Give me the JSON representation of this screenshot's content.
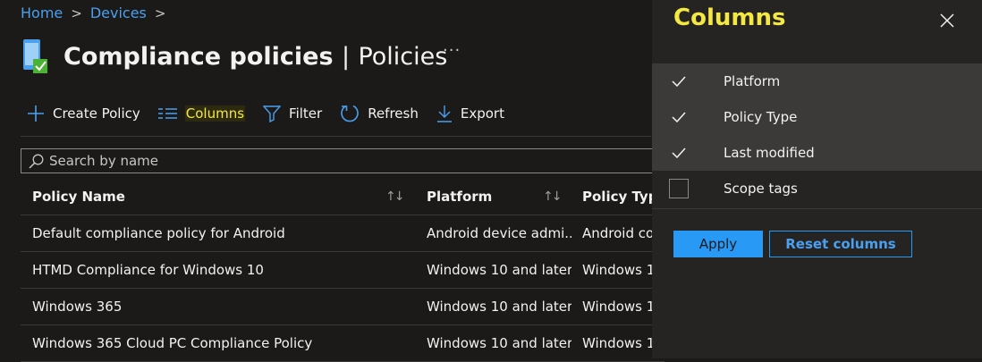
{
  "breadcrumb": {
    "items": [
      "Home",
      "Devices"
    ]
  },
  "page": {
    "title": "Compliance policies",
    "subtitle": "Policies",
    "separator": "|",
    "more": "···"
  },
  "toolbar": {
    "create": "Create Policy",
    "columns": "Columns",
    "filter": "Filter",
    "refresh": "Refresh",
    "export": "Export"
  },
  "search": {
    "placeholder": "Search by name",
    "value": ""
  },
  "table": {
    "headers": [
      "Policy Name",
      "Platform",
      "Policy Type"
    ],
    "rows": [
      [
        "Default compliance policy for Android",
        "Android device admi...",
        "Android co"
      ],
      [
        "HTMD Compliance for Windows 10",
        "Windows 10 and later",
        "Windows 1"
      ],
      [
        "Windows 365",
        "Windows 10 and later",
        "Windows 1"
      ],
      [
        "Windows 365 Cloud PC Compliance Policy",
        "Windows 10 and later",
        "Windows 1"
      ]
    ]
  },
  "panel": {
    "title": "Columns",
    "options": [
      {
        "label": "Platform",
        "checked": true
      },
      {
        "label": "Policy Type",
        "checked": true
      },
      {
        "label": "Last modified",
        "checked": true
      },
      {
        "label": "Scope tags",
        "checked": false
      }
    ],
    "apply": "Apply",
    "reset": "Reset columns"
  },
  "colors": {
    "background": "#1b1a19",
    "panel": "#252423",
    "accent": "#2899f5",
    "link": "#4aa0ef",
    "highlight_text": "#f4e842"
  },
  "icons": {
    "title": "device-compliance-icon",
    "create": "plus-icon",
    "columns": "columns-icon",
    "filter": "filter-icon",
    "refresh": "refresh-icon",
    "export": "download-icon",
    "search": "search-icon",
    "close": "close-icon",
    "sort": "sort-arrows-icon"
  }
}
